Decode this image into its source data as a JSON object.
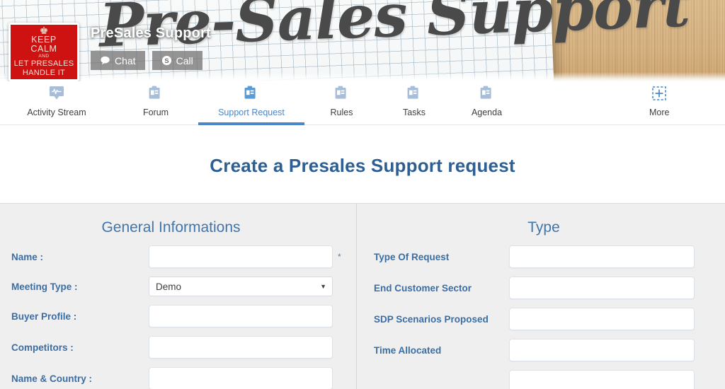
{
  "banner": {
    "script_text": "Pre-Sales Support",
    "site_title": "PreSales Support",
    "poster": {
      "crown": "♚",
      "line1": "KEEP",
      "line2": "CALM",
      "and": "AND",
      "line3": "LET PRESALES",
      "line4": "HANDLE IT"
    },
    "buttons": [
      {
        "label": "Chat",
        "icon": "chat-bubble-icon"
      },
      {
        "label": "Call",
        "icon": "skype-icon"
      }
    ]
  },
  "nav": {
    "tabs": [
      {
        "label": "Activity Stream",
        "icon": "activity-monitor-icon",
        "active": false
      },
      {
        "label": "Forum",
        "icon": "clipboard-icon",
        "active": false
      },
      {
        "label": "Support Request",
        "icon": "clipboard-icon",
        "active": true
      },
      {
        "label": "Rules",
        "icon": "clipboard-icon",
        "active": false
      },
      {
        "label": "Tasks",
        "icon": "clipboard-icon",
        "active": false
      },
      {
        "label": "Agenda",
        "icon": "clipboard-icon",
        "active": false
      },
      {
        "label": "More",
        "icon": "plus-dashed-icon",
        "active": false
      }
    ],
    "active_color": "#4a86c8"
  },
  "page": {
    "title": "Create a Presales Support request"
  },
  "form": {
    "left": {
      "heading": "General Informations",
      "fields": [
        {
          "label": "Name :",
          "type": "text",
          "value": "",
          "required_mark": "*"
        },
        {
          "label": "Meeting Type :",
          "type": "select",
          "value": "Demo",
          "caret": "▼"
        },
        {
          "label": "Buyer Profile :",
          "type": "text",
          "value": ""
        },
        {
          "label": "Competitors :",
          "type": "text",
          "value": ""
        },
        {
          "label": "Name & Country :",
          "type": "text",
          "value": ""
        }
      ]
    },
    "right": {
      "heading": "Type",
      "fields": [
        {
          "label": "Type Of Request",
          "type": "text",
          "value": ""
        },
        {
          "label": "End Customer Sector",
          "type": "text",
          "value": ""
        },
        {
          "label": "SDP Scenarios Proposed",
          "type": "text",
          "value": ""
        },
        {
          "label": "Time Allocated",
          "type": "text",
          "value": ""
        },
        {
          "label": "",
          "type": "text",
          "value": ""
        }
      ]
    }
  },
  "colors": {
    "accent_blue": "#4a86c8",
    "title_blue": "#2e5f93",
    "label_blue": "#3a6ea5",
    "heading_blue": "#4076ab",
    "panel_bg": "#efefef",
    "poster_red": "#ce1111"
  }
}
